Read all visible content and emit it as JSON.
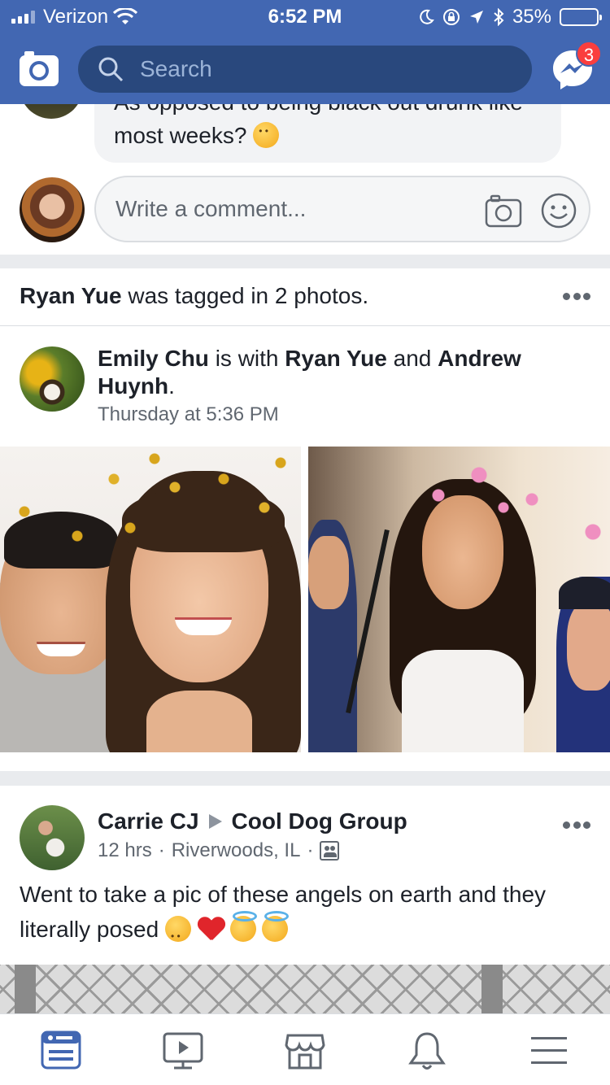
{
  "status_bar": {
    "carrier": "Verizon",
    "time": "6:52 PM",
    "battery": "35%",
    "battery_level": 0.35
  },
  "header": {
    "search_placeholder": "Search",
    "messenger_badge": "3"
  },
  "comment_thread": {
    "last_comment_cut": "As opposed to being black out drunk like",
    "last_comment_text": "most weeks?",
    "last_comment_emoji": "thinking-face-icon",
    "write_placeholder": "Write a comment..."
  },
  "tagged_story": {
    "subject": "Ryan Yue",
    "rest": " was tagged in 2 photos.",
    "poster": "Emily Chu",
    "with_text": " is with ",
    "tagged_1": "Ryan Yue",
    "and_text": " and ",
    "tagged_2": "Andrew Huynh",
    "period": ".",
    "time": "Thursday at 5:36 PM"
  },
  "group_post": {
    "author": "Carrie CJ",
    "group": "Cool Dog Group",
    "age": "12 hrs",
    "location": "Riverwoods, IL",
    "sep": "·",
    "text": "Went to take a pic of these angels on earth and they literally posed",
    "emojis": [
      "crying-face-icon",
      "red-heart-icon",
      "smiling-angel-icon",
      "smiling-angel-icon"
    ]
  },
  "tabs": [
    "news-feed-tab",
    "watch-tab",
    "marketplace-tab",
    "notifications-tab",
    "menu-tab"
  ],
  "colors": {
    "brand": "#4267b2",
    "search_bg": "#29487d",
    "badge": "#fa3e3e",
    "active_tab": "#4267b2",
    "inactive_tab": "#606770"
  }
}
